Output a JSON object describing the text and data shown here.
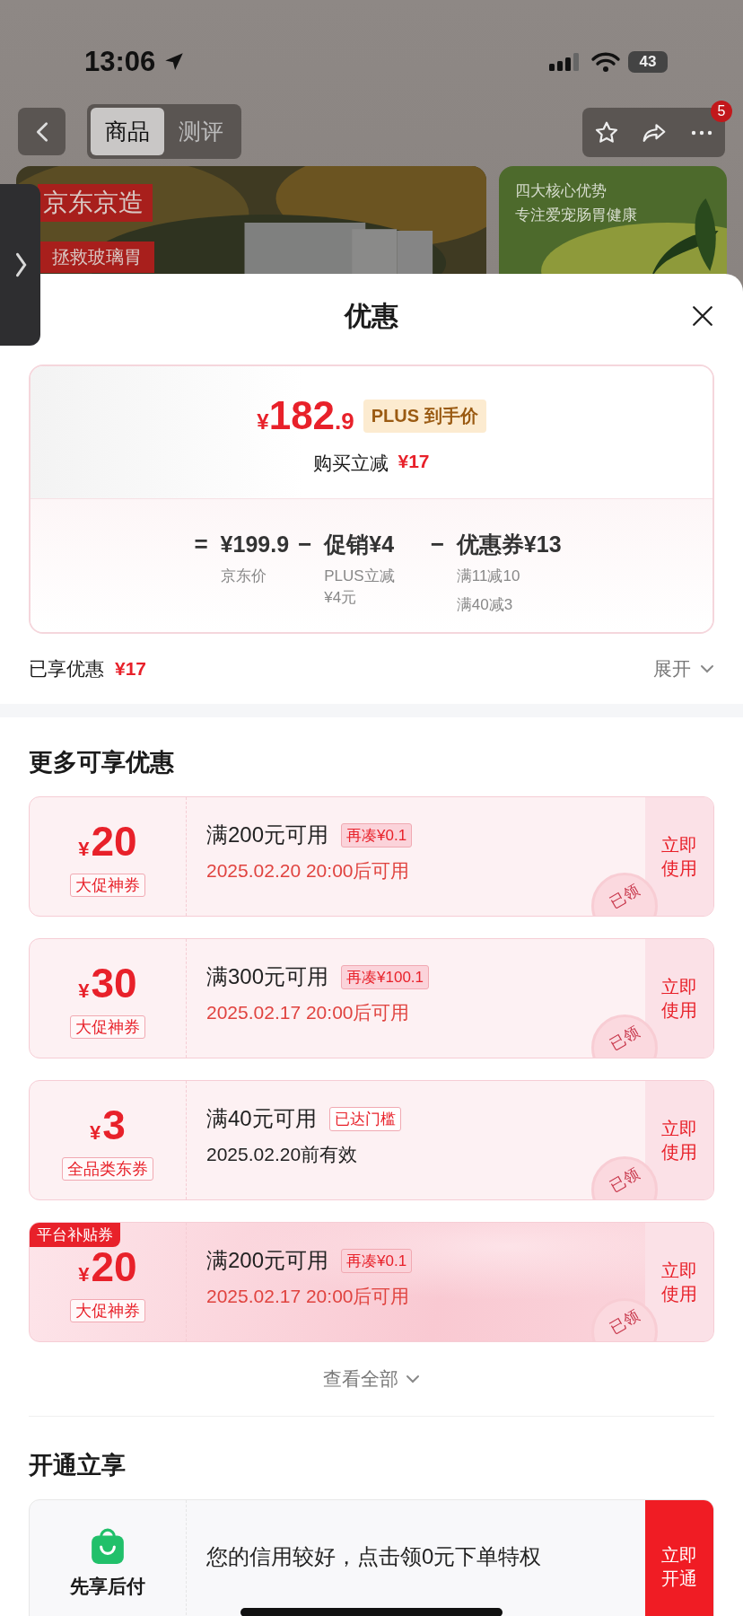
{
  "status_bar": {
    "time": "13:06",
    "battery": "43"
  },
  "nav": {
    "tabs": [
      {
        "label": "商品",
        "selected": true
      },
      {
        "label": "测评",
        "selected": false
      }
    ],
    "badge": "5"
  },
  "banners": [
    {
      "kind": "product",
      "texts": [
        "京东京造",
        "拯救玻璃胃"
      ]
    },
    {
      "kind": "feature",
      "texts": [
        "四大核心优势",
        "专注爱宠肠胃健康"
      ]
    }
  ],
  "sheet": {
    "title": "优惠"
  },
  "price_card": {
    "currency": "¥",
    "price_integer": "182",
    "price_decimal": ".9",
    "price_tag": "PLUS 到手价",
    "saving_label": "购买立减",
    "saving_amount": "¥17",
    "breakdown": [
      {
        "operator": "=",
        "value": "¥199.9",
        "notes": [
          "京东价"
        ]
      },
      {
        "operator": "−",
        "value": "促销¥4",
        "notes": [
          "PLUS立减¥4元"
        ]
      },
      {
        "operator": "−",
        "value": "优惠券¥13",
        "notes": [
          "满11减10",
          "满40减3"
        ]
      }
    ]
  },
  "enjoyed": {
    "label": "已享优惠",
    "amount": "¥17",
    "expand": "展开"
  },
  "more_offers": {
    "title": "更多可享优惠",
    "coupons": [
      {
        "currency": "¥",
        "amount": "20",
        "type": "大促神券",
        "condition": "满200元可用",
        "tag": {
          "kind": "shortfall",
          "text": "再凑¥0.1"
        },
        "validity": "2025.02.20 20:00后可用",
        "color": "#e0433f",
        "stamp": "已领",
        "button": "立即使用",
        "highlighted": false
      },
      {
        "currency": "¥",
        "amount": "30",
        "type": "大促神券",
        "condition": "满300元可用",
        "tag": {
          "kind": "shortfall",
          "text": "再凑¥100.1"
        },
        "validity": "2025.02.17 20:00后可用",
        "color": "#e0433f",
        "stamp": "已领",
        "button": "立即使用",
        "highlighted": false
      },
      {
        "currency": "¥",
        "amount": "3",
        "type": "全品类东券",
        "condition": "满40元可用",
        "tag": {
          "kind": "reached",
          "text": "已达门槛"
        },
        "validity": "2025.02.20前有效",
        "color": "#222222",
        "stamp": "已领",
        "button": "立即使用",
        "highlighted": false
      },
      {
        "ribbon": "平台补贴券",
        "currency": "¥",
        "amount": "20",
        "type": "大促神券",
        "condition": "满200元可用",
        "tag": {
          "kind": "shortfall",
          "text": "再凑¥0.1"
        },
        "validity": "2025.02.17 20:00后可用",
        "color": "#e0433f",
        "stamp": "已领",
        "button": "立即使用",
        "highlighted": true
      }
    ],
    "view_all": "查看全部"
  },
  "activate": {
    "title": "开通立享",
    "service": "先享后付",
    "message": "您的信用较好，点击领0元下单特权",
    "button": "立即开通"
  }
}
